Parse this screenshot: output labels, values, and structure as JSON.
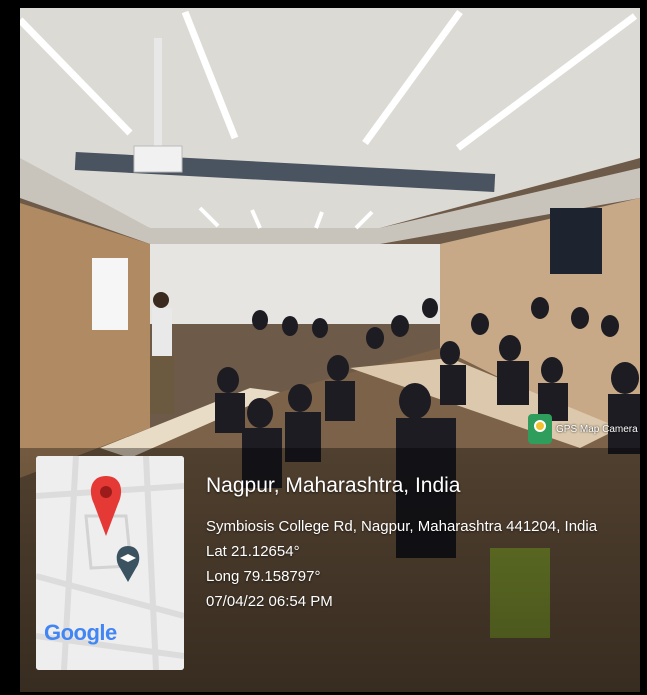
{
  "location": {
    "place": "Nagpur, Maharashtra, India",
    "address": "Symbiosis College Rd, Nagpur, Maharashtra 441204, India",
    "lat": "Lat 21.12654°",
    "long": "Long 79.158797°",
    "datetime": "07/04/22 06:54 PM"
  },
  "badge": {
    "label": "GPS Map Camera",
    "icon": "gps-map-camera-icon"
  },
  "map": {
    "logo": "Google",
    "pin_icon": "map-pin-icon",
    "place_icon": "graduation-cap-icon"
  },
  "colors": {
    "pin": "#e53935",
    "wall": "#cdb89c",
    "ceiling": "#d9d7d2"
  }
}
